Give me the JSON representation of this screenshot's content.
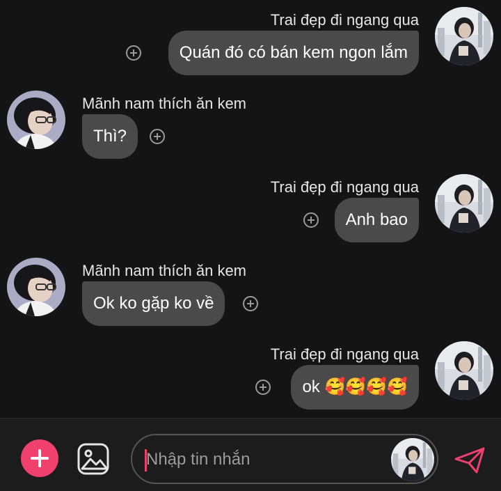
{
  "messages": [
    {
      "sender": "Trai đẹp đi ngang qua",
      "text": "Quán đó có bán kem ngon lắm",
      "side": "right"
    },
    {
      "sender": "Mãnh nam thích ăn kem",
      "text": "Thì?",
      "side": "left"
    },
    {
      "sender": "Trai đẹp đi ngang qua",
      "text": "Anh bao",
      "side": "right"
    },
    {
      "sender": "Mãnh nam thích ăn kem",
      "text": "Ok ko gặp ko về",
      "side": "left"
    },
    {
      "sender": "Trai đẹp đi ngang qua",
      "text": "ok 🥰🥰🥰🥰",
      "side": "right"
    }
  ],
  "composer": {
    "placeholder": "Nhập tin nhắn"
  },
  "colors": {
    "background": "#141414",
    "bubble": "#4a4a4a",
    "accent": "#f0416e"
  },
  "icons": {
    "add": "plus-icon",
    "gallery": "image-icon",
    "send": "send-icon",
    "react": "add-reaction-icon"
  }
}
